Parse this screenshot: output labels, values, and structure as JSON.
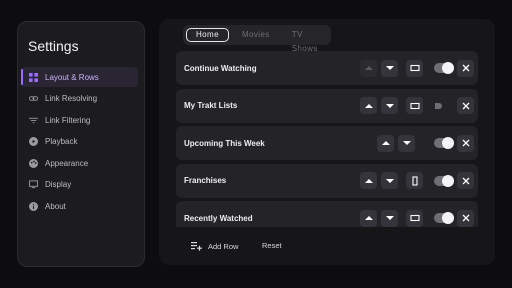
{
  "sidebar": {
    "title": "Settings",
    "items": [
      {
        "label": "Layout & Rows",
        "icon": "grid-icon",
        "active": true
      },
      {
        "label": "Link Resolving",
        "icon": "link-icon"
      },
      {
        "label": "Link Filtering",
        "icon": "filter-icon"
      },
      {
        "label": "Playback",
        "icon": "play-circle-icon"
      },
      {
        "label": "Appearance",
        "icon": "palette-icon"
      },
      {
        "label": "Display",
        "icon": "monitor-icon"
      },
      {
        "label": "About",
        "icon": "info-icon"
      }
    ]
  },
  "tabs": [
    {
      "label": "Home",
      "active": true
    },
    {
      "label": "Movies"
    },
    {
      "label": "TV Shows"
    }
  ],
  "rows": [
    {
      "label": "Continue Watching",
      "up_enabled": false,
      "down_enabled": true,
      "layout": "landscape",
      "enabled": true
    },
    {
      "label": "My Trakt Lists",
      "up_enabled": true,
      "down_enabled": true,
      "layout": "landscape",
      "enabled": false
    },
    {
      "label": "Upcoming This Week",
      "up_enabled": true,
      "down_enabled": true,
      "layout": null,
      "enabled": true
    },
    {
      "label": "Franchises",
      "up_enabled": true,
      "down_enabled": true,
      "layout": "portrait",
      "enabled": true
    },
    {
      "label": "Recently Watched",
      "up_enabled": true,
      "down_enabled": true,
      "layout": "landscape",
      "enabled": true
    }
  ],
  "footer": {
    "add_row_label": "Add Row",
    "reset_label": "Reset"
  },
  "colors": {
    "accent": "#9b6cff",
    "background": "#0d0d0f",
    "panel": "#1c1c1f",
    "row": "#242428"
  }
}
